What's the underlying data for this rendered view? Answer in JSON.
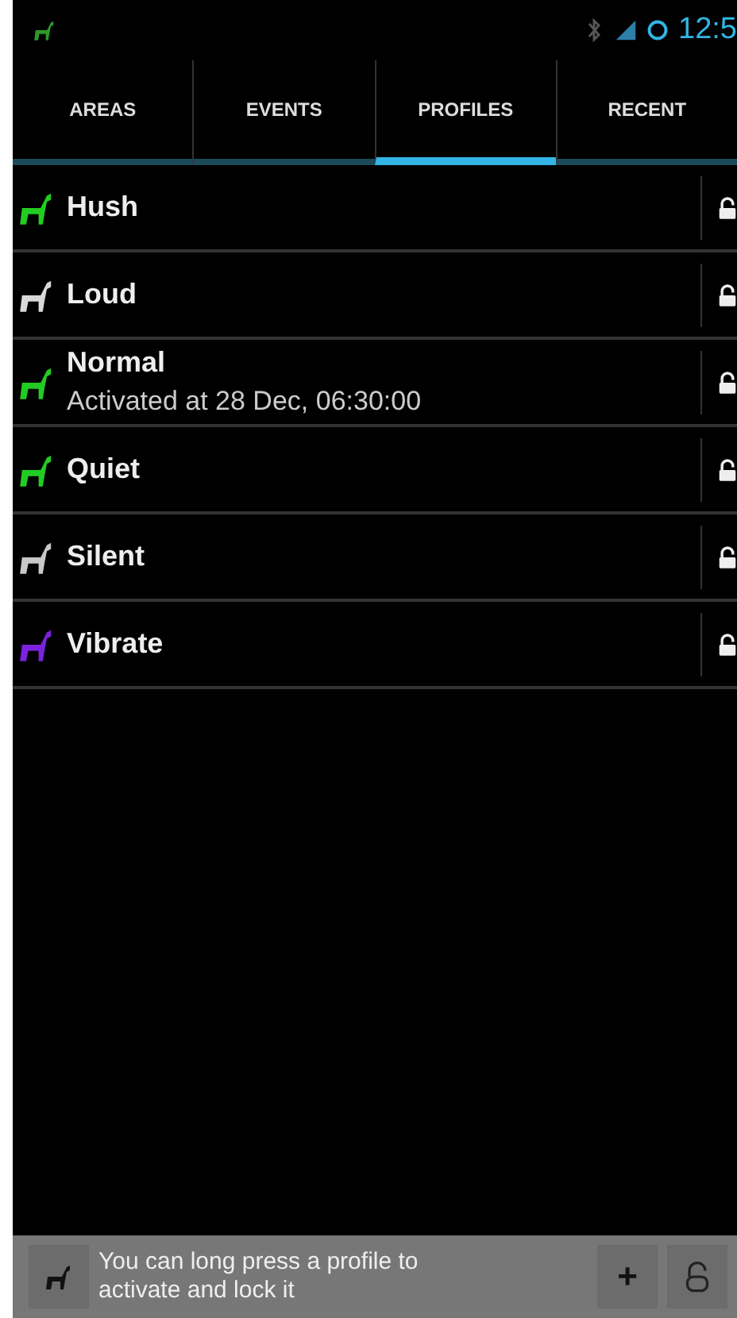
{
  "status_bar": {
    "time": "12:5"
  },
  "tabs": [
    {
      "label": "AREAS",
      "selected": false
    },
    {
      "label": "EVENTS",
      "selected": false
    },
    {
      "label": "PROFILES",
      "selected": true
    },
    {
      "label": "RECENT",
      "selected": false
    }
  ],
  "profiles": [
    {
      "name": "Hush",
      "color": "#22cc22"
    },
    {
      "name": "Loud",
      "color": "#d8d8d8"
    },
    {
      "name": "Normal",
      "color": "#22cc22",
      "detail": "Activated at 28 Dec, 06:30:00"
    },
    {
      "name": "Quiet",
      "color": "#22cc22"
    },
    {
      "name": "Silent",
      "color": "#c8c8c8"
    },
    {
      "name": "Vibrate",
      "color": "#7a22dd"
    }
  ],
  "hint": "You can long press a profile to activate and lock it",
  "add_button": "+"
}
